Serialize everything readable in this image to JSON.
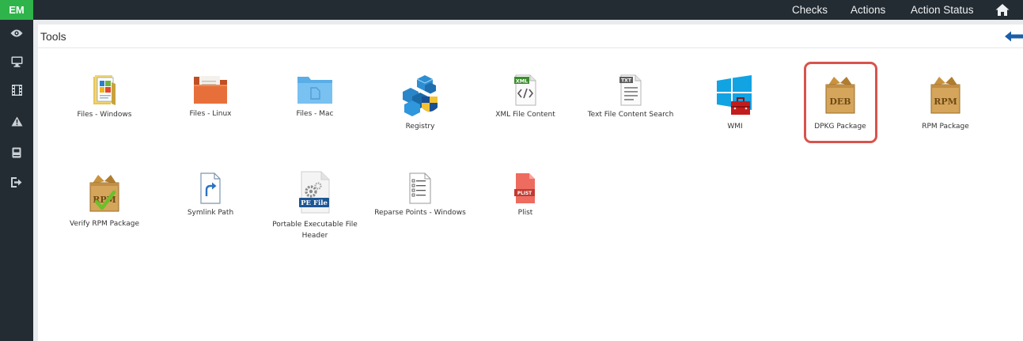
{
  "app": {
    "logo": "EM"
  },
  "nav": {
    "checks": "Checks",
    "actions": "Actions",
    "action_status": "Action Status"
  },
  "panel": {
    "title": "Tools"
  },
  "tools": [
    {
      "label": "Files - Windows",
      "icon": "files-windows-icon"
    },
    {
      "label": "Files - Linux",
      "icon": "files-linux-icon"
    },
    {
      "label": "Files - Mac",
      "icon": "files-mac-icon"
    },
    {
      "label": "Registry",
      "icon": "registry-icon"
    },
    {
      "label": "XML File Content",
      "icon": "xml-file-icon",
      "badge": "XML"
    },
    {
      "label": "Text File Content Search",
      "icon": "text-file-icon",
      "badge": "TXT"
    },
    {
      "label": "WMI",
      "icon": "wmi-icon"
    },
    {
      "label": "DPKG Package",
      "icon": "deb-package-icon",
      "badge": "DEB"
    },
    {
      "label": "RPM Package",
      "icon": "rpm-package-icon",
      "badge": "RPM"
    },
    {
      "label": "Verify RPM Package",
      "icon": "verify-rpm-icon",
      "badge": "RPM"
    },
    {
      "label": "Symlink Path",
      "icon": "symlink-icon"
    },
    {
      "label": "Portable Executable File Header",
      "icon": "pe-file-icon",
      "badge": "PE File"
    },
    {
      "label": "Reparse Points - Windows",
      "icon": "reparse-points-icon"
    },
    {
      "label": "Plist",
      "icon": "plist-icon",
      "badge": "PLIST"
    }
  ],
  "colors": {
    "topbar": "#232c32",
    "logo_bg": "#2fb44b",
    "highlight": "#d8534d",
    "back_arrow": "#1c5ea8"
  }
}
